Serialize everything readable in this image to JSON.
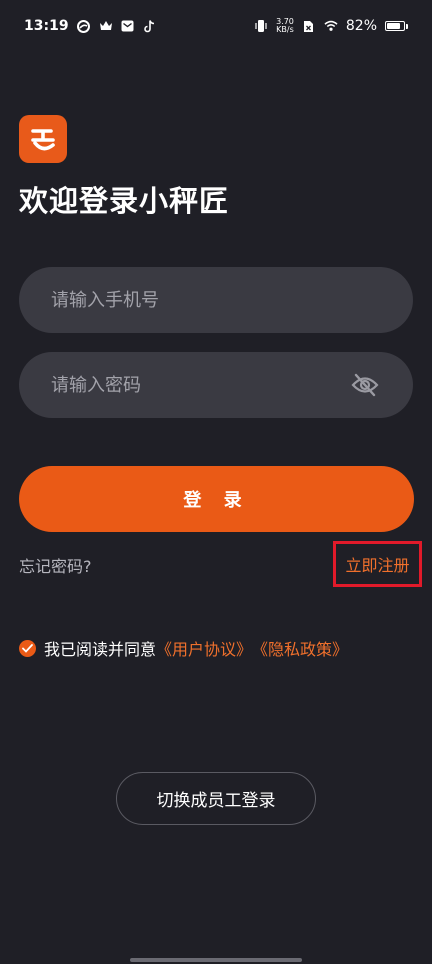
{
  "status_bar": {
    "time": "13:19",
    "net_speed_value": "3.70",
    "net_speed_unit": "KB/s",
    "battery": "82%",
    "battery_level": 0.82,
    "icons": [
      "swirl-icon",
      "crown-icon",
      "mail-icon",
      "tiktok-icon",
      "vibrate-icon",
      "sim-off-icon",
      "wifi-icon"
    ]
  },
  "app": {
    "welcome_title": "欢迎登录小秤匠",
    "brand_color": "#e85a1a"
  },
  "form": {
    "phone_placeholder": "请输入手机号",
    "password_placeholder": "请输入密码",
    "login_label": "登 录",
    "forgot_label": "忘记密码?",
    "register_label": "立即注册"
  },
  "agreement": {
    "checked": true,
    "prefix": "我已阅读并同意",
    "user_agreement": "《用户协议》",
    "privacy_policy": "《隐私政策》"
  },
  "switch_label": "切换成员工登录",
  "colors": {
    "background": "#1f1f26",
    "field": "#3a3a42",
    "accent": "#ea5a16",
    "link": "#f0702c",
    "highlight": "#e11a2a"
  }
}
